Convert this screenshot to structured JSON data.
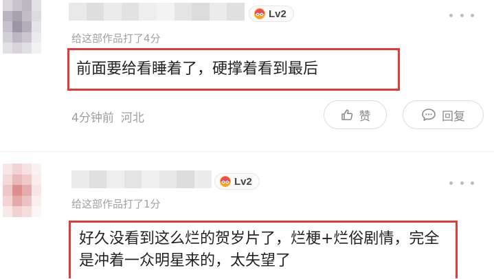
{
  "comments": [
    {
      "badge": "Lv2",
      "rating_text": "给这部作品打了4分",
      "content": "前面要给看睡着了，硬撑着看到最后",
      "time": "4分钟前",
      "location": "河北",
      "like_label": "赞",
      "reply_label": "回复"
    },
    {
      "badge": "Lv2",
      "rating_text": "给这部作品打了1分",
      "content": "好久没看到这么烂的贺岁片了，烂梗+烂俗剧情，完全是冲着一众明星来的，太失望了"
    }
  ],
  "colors": {
    "highlight_border": "#e53935",
    "muted_text": "#9e9e9e"
  },
  "icons": [
    "more-icon",
    "like-icon",
    "reply-icon",
    "level-icon"
  ]
}
